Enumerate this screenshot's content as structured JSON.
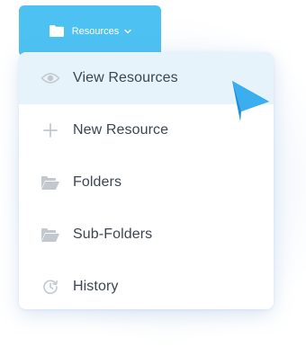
{
  "trigger": {
    "label": "Resources",
    "icon": "folder-icon",
    "chevron": "chevron-down-icon",
    "color": "#4cc1f2"
  },
  "menu": {
    "items": [
      {
        "label": "View Resources",
        "icon": "eye-icon",
        "active": true
      },
      {
        "label": "New Resource",
        "icon": "plus-icon",
        "active": false
      },
      {
        "label": "Folders",
        "icon": "folder-open-icon",
        "active": false
      },
      {
        "label": "Sub-Folders",
        "icon": "folder-open-icon",
        "active": false
      },
      {
        "label": "History",
        "icon": "history-icon",
        "active": false
      }
    ],
    "active_bg": "#e7f3fb",
    "icon_color": "#c3c8ce",
    "text_color": "#3d4550"
  },
  "cursor": {
    "icon": "pointer-arrow-icon",
    "color": "#2e9fe6"
  }
}
